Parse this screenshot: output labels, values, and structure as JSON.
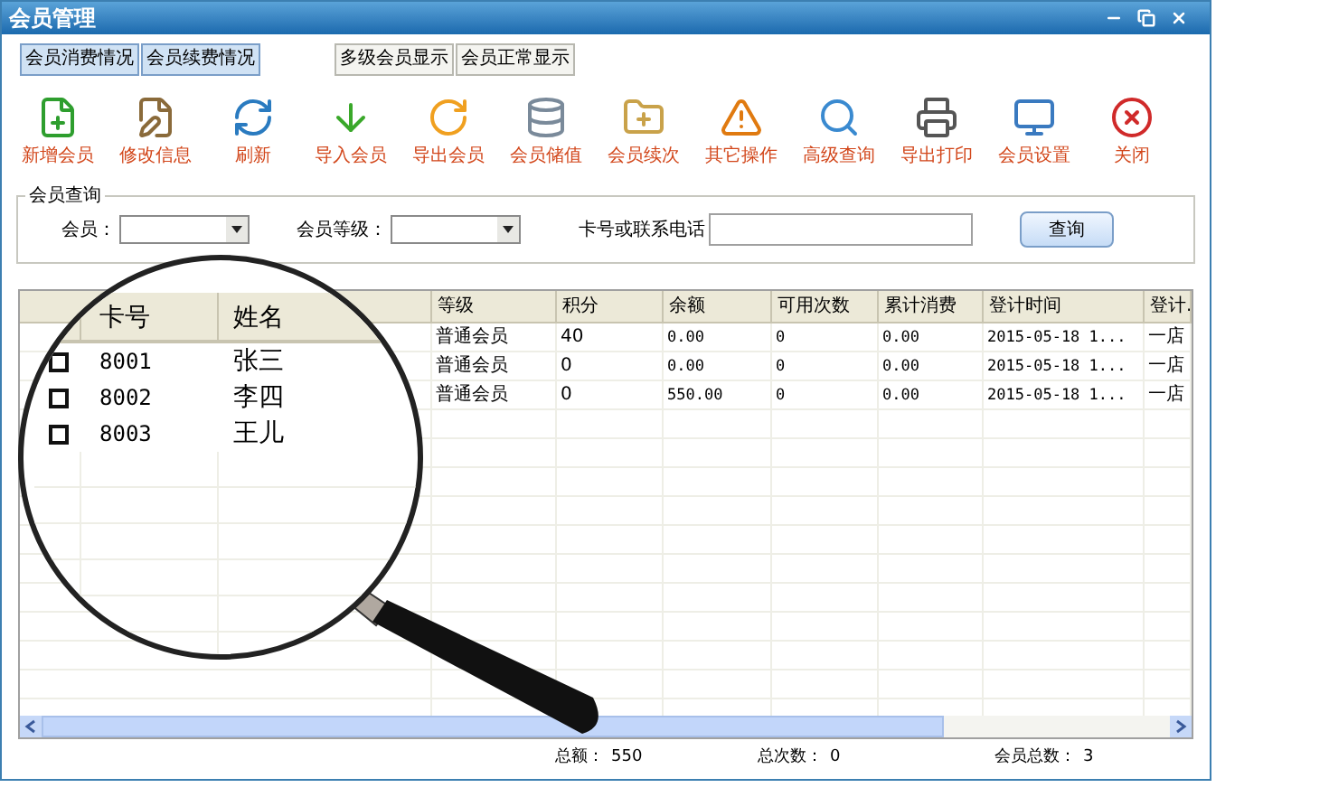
{
  "window": {
    "title": "会员管理"
  },
  "top_buttons": [
    {
      "label": "会员消费情况",
      "selected": true
    },
    {
      "label": "会员续费情况",
      "selected": true
    },
    {
      "label": "多级会员显示",
      "selected": false
    },
    {
      "label": "会员正常显示",
      "selected": false
    }
  ],
  "toolbar": [
    {
      "label": "新增会员",
      "kind": "add"
    },
    {
      "label": "修改信息",
      "kind": "edit"
    },
    {
      "label": "刷新",
      "kind": "refresh"
    },
    {
      "label": "导入会员",
      "kind": "import"
    },
    {
      "label": "导出会员",
      "kind": "export"
    },
    {
      "label": "会员储值",
      "kind": "store"
    },
    {
      "label": "会员续次",
      "kind": "renew"
    },
    {
      "label": "其它操作",
      "kind": "warn"
    },
    {
      "label": "高级查询",
      "kind": "search"
    },
    {
      "label": "导出打印",
      "kind": "print"
    },
    {
      "label": "会员设置",
      "kind": "settings"
    },
    {
      "label": "关闭",
      "kind": "close"
    }
  ],
  "search": {
    "title": "会员查询",
    "fields": [
      {
        "label": "会员：",
        "kind": "select"
      },
      {
        "label": "会员等级：",
        "kind": "select"
      },
      {
        "label": "卡号或联系电话",
        "kind": "text"
      }
    ],
    "button": "查询"
  },
  "table": {
    "columns": [
      "卡号",
      "姓名",
      "等级",
      "积分",
      "余额",
      "可用次数",
      "累计消费",
      "登计时间",
      "登计."
    ],
    "rows": [
      {
        "checked": false,
        "cells": [
          "8001",
          "张三",
          "普通会员",
          "40",
          "0.00",
          "0",
          "0.00",
          "2015-05-18 1...",
          "一店"
        ]
      },
      {
        "checked": false,
        "cells": [
          "8002",
          "李四",
          "普通会员",
          "0",
          "0.00",
          "0",
          "0.00",
          "2015-05-18 1...",
          "一店"
        ]
      },
      {
        "checked": false,
        "cells": [
          "8003",
          "王儿",
          "普通会员",
          "0",
          "550.00",
          "0",
          "0.00",
          "2015-05-18 1...",
          "一店"
        ]
      }
    ]
  },
  "status_bar": [
    {
      "label": "总额：",
      "value": "550"
    },
    {
      "label": "总次数：",
      "value": "0"
    },
    {
      "label": "会员总数：",
      "value": "3"
    }
  ]
}
